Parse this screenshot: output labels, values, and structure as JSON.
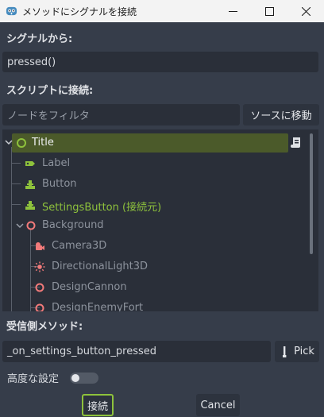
{
  "window": {
    "title": "メソッドにシグナルを接続",
    "icons": {
      "app": "godot-icon",
      "minimize": "minimize-icon",
      "maximize": "maximize-icon",
      "close": "close-icon"
    }
  },
  "signal_section": {
    "label": "シグナルから:",
    "value": "pressed()"
  },
  "script_section": {
    "label": "スクリプトに接続:",
    "filter_placeholder": "ノードをフィルタ",
    "goto_source_label": "ソースに移動"
  },
  "tree": {
    "nodes": [
      {
        "label": "Title",
        "icon": "circle-node-icon",
        "selected": true,
        "status": "active"
      },
      {
        "label": "Label",
        "icon": "label-icon",
        "status": "disabled"
      },
      {
        "label": "Button",
        "icon": "button-icon",
        "status": "disabled"
      },
      {
        "label": "SettingsButton (接続元)",
        "icon": "button-icon",
        "status": "source"
      },
      {
        "label": "Background",
        "icon": "node3d-icon",
        "status": "disabled"
      },
      {
        "label": "Camera3D",
        "icon": "camera-icon",
        "status": "disabled"
      },
      {
        "label": "DirectionalLight3D",
        "icon": "sun-light-icon",
        "status": "disabled"
      },
      {
        "label": "DesignCannon",
        "icon": "node3d-icon",
        "status": "disabled"
      },
      {
        "label": "DesignEnemyFort",
        "icon": "node3d-icon",
        "status": "disabled"
      }
    ],
    "script_icon": "script-icon"
  },
  "receiver": {
    "label": "受信側メソッド:",
    "method": "_on_settings_button_pressed",
    "pick_label": "Pick",
    "pick_icon": "eyedropper-icon"
  },
  "advanced": {
    "label": "高度な設定",
    "enabled": false
  },
  "actions": {
    "connect_label": "接続",
    "cancel_label": "Cancel"
  },
  "colors": {
    "background": "#363d4a",
    "field": "#2a2f39",
    "selected_row": "#4b5a2a",
    "accent_green": "#8ec23c",
    "node_red": "#f27a7a",
    "text_disabled": "#8d939d"
  }
}
